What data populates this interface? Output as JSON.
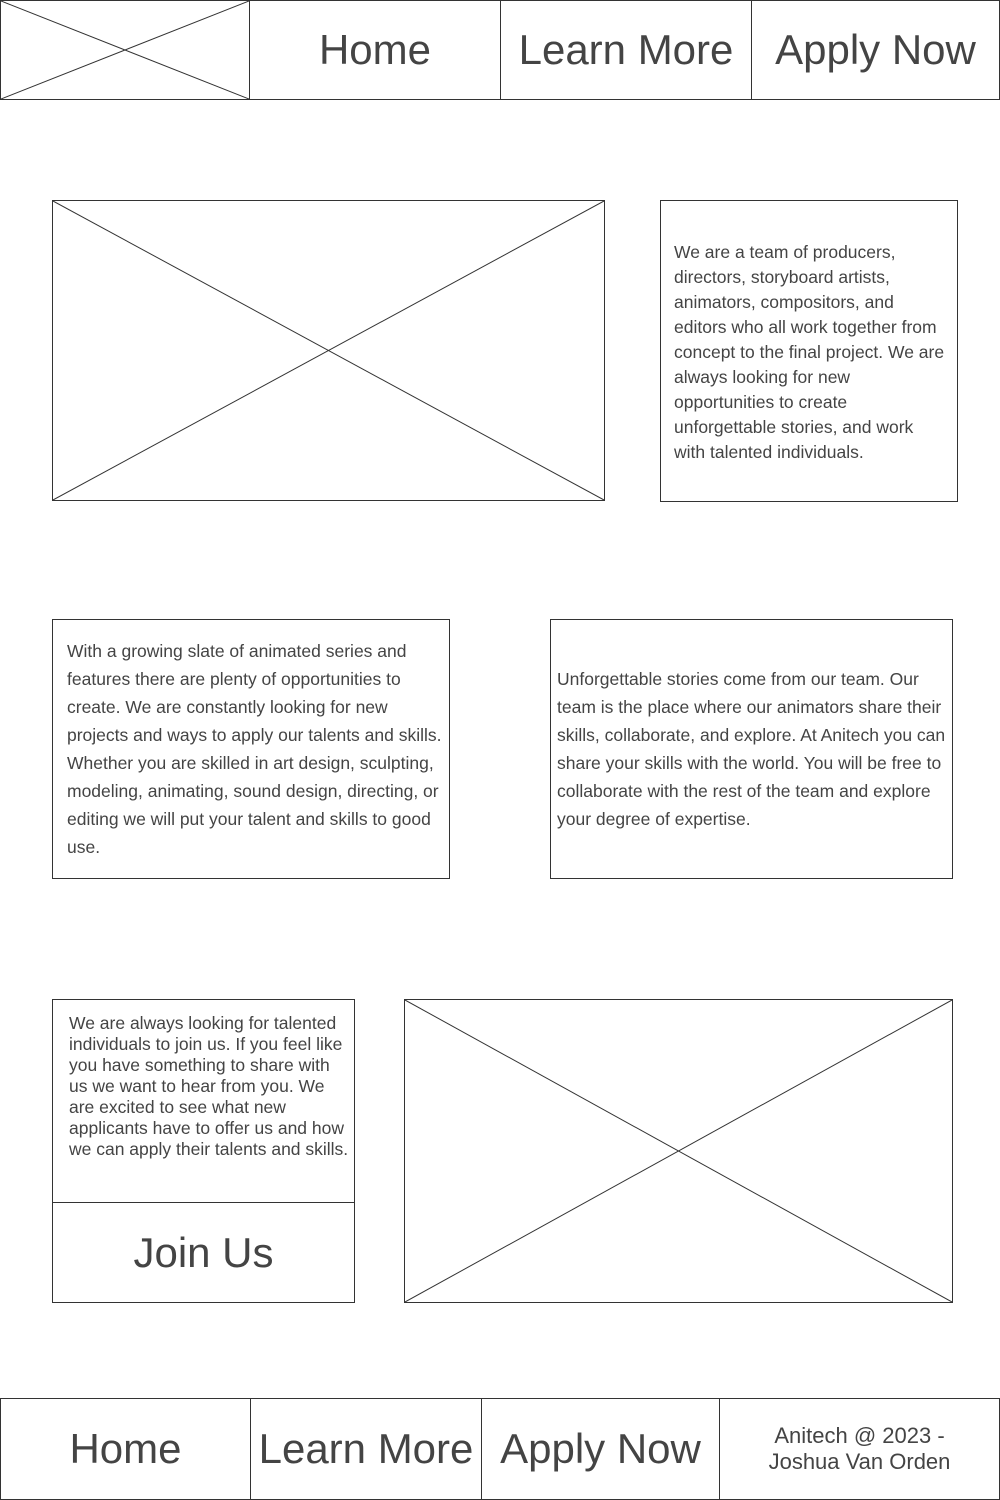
{
  "header": {
    "nav": [
      "Home",
      "Learn More",
      "Apply Now"
    ]
  },
  "intro": {
    "text": "We are a team of producers, directors, storyboard artists, animators, compositors, and editors who all work together from concept to the final project. We are always looking for new opportunities to create unforgettable stories, and work with talented individuals."
  },
  "opportunities": {
    "text": "With a growing slate of animated series and features there are plenty of opportunities to create. We are constantly looking for new projects and ways to apply our talents and skills. Whether you are skilled in art design, sculpting, modeling, animating, sound design, directing, or editing we will put your talent and skills to good use."
  },
  "team": {
    "text": "Unforgettable stories come from our team. Our team is the place where our animators share their skills, collaborate, and explore. At Anitech you can share your skills with the world. You will be free to collaborate with the rest of the team and explore your degree of expertise."
  },
  "join": {
    "text": "We are always looking for talented individuals to join us. If you feel like you have something to share with us we want to hear from you. We are excited to see what new applicants have to offer us and how we can apply their talents and skills.",
    "button": "Join Us"
  },
  "footer": {
    "nav": [
      "Home",
      "Learn More",
      "Apply Now"
    ],
    "copyright": "Anitech @ 2023 - Joshua Van Orden"
  }
}
